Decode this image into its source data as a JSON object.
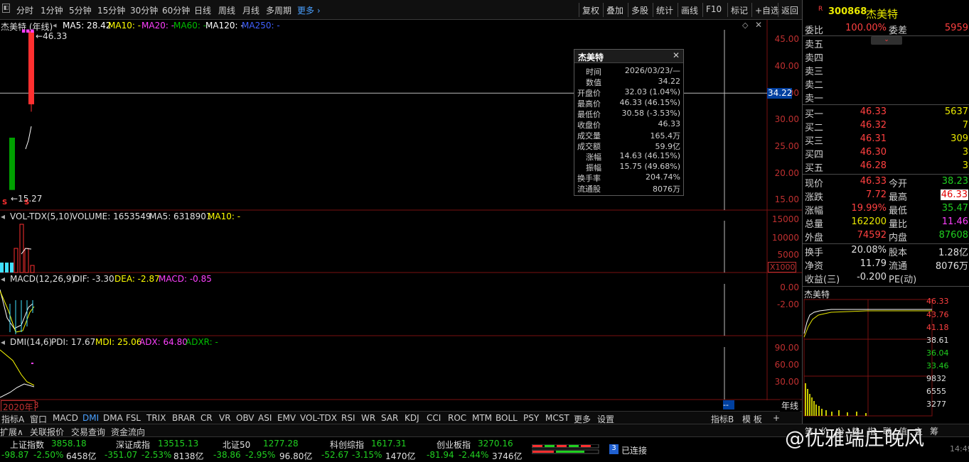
{
  "colors": {
    "up": "#ff3030",
    "down": "#00a000",
    "ma5": "#ffffff",
    "ma10": "#ffff00",
    "ma20": "#ff40ff",
    "ma60": "#00c000",
    "ma250": "#4060ff"
  },
  "toolbar": {
    "periods": [
      "分时",
      "1分钟",
      "5分钟",
      "15分钟",
      "30分钟",
      "60分钟",
      "日线",
      "周线",
      "月线",
      "多周期"
    ],
    "more": "更多",
    "right": [
      "复权",
      "叠加",
      "多股",
      "统计",
      "画线",
      "F10",
      "标记",
      "+自选",
      "返回"
    ]
  },
  "main": {
    "title": "杰美特 (年线)",
    "ma5": "MA5: 28.42",
    "ma10": "MA10: -",
    "ma20": "MA20: -",
    "ma60": "MA60: -",
    "ma120": "MA120: -",
    "ma250": "MA250: -",
    "high_label": "46.33",
    "low_label": "15.27",
    "cursor_price": "34.22",
    "axis": [
      "45.00",
      "40.00",
      "35.00",
      "30.00",
      "25.00",
      "20.00",
      "15.00"
    ]
  },
  "chart_data": [
    {
      "type": "candlestick",
      "x": [
        "2020",
        "2021"
      ],
      "open": [
        25.5,
        32.03
      ],
      "high": [
        25.5,
        46.33
      ],
      "low": [
        15.27,
        30.58
      ],
      "close": [
        15.27,
        46.33
      ],
      "ma5": [
        null,
        28.42
      ],
      "ylim": [
        13,
        48
      ],
      "yticks": [
        45,
        40,
        35,
        30,
        25,
        20,
        15
      ]
    },
    {
      "type": "bar",
      "series": [
        {
          "name": "VOLUME",
          "values": [
            1653549
          ]
        }
      ],
      "yticks": [
        15000,
        10000,
        5000
      ],
      "unit": "X1000"
    },
    {
      "type": "line",
      "series": [
        {
          "name": "DIF",
          "values": [
            -3.3
          ]
        },
        {
          "name": "DEA",
          "values": [
            -2.87
          ]
        },
        {
          "name": "MACD",
          "values": [
            -0.85
          ]
        }
      ],
      "yticks": [
        0,
        -2
      ]
    },
    {
      "type": "line",
      "series": [
        {
          "name": "PDI",
          "values": [
            17.67
          ]
        },
        {
          "name": "MDI",
          "values": [
            25.06
          ]
        },
        {
          "name": "ADX",
          "values": [
            64.8
          ]
        }
      ],
      "yticks": [
        90,
        60,
        30
      ]
    }
  ],
  "vol": {
    "title": "VOL-TDX(5,10)",
    "volume": "VOLUME: 1653549",
    "ma5": "MA5: 6318901",
    "ma10": "MA10: -",
    "axis": [
      "15000",
      "10000",
      "5000"
    ],
    "unit": "X1000"
  },
  "macd": {
    "title": "MACD(12,26,9)",
    "dif": "DIF: -3.30",
    "dea": "DEA: -2.87",
    "macd": "MACD: -0.85",
    "axis": [
      "0.00",
      "-2.00"
    ]
  },
  "dmi": {
    "title": "DMI(14,6)",
    "pdi": "PDI: 17.67",
    "mdi": "MDI: 25.06",
    "adx": "ADX: 64.80",
    "adxr": "ADXR: -",
    "axis": [
      "90.00",
      "60.00",
      "30.00"
    ]
  },
  "xaxis": {
    "year": "2020年",
    "num": "3",
    "cursor": "--"
  },
  "popup": {
    "title": "杰美特",
    "close": "✕",
    "rows": [
      {
        "k": "时间",
        "v": "2026/03/23/—"
      },
      {
        "k": "数值",
        "v": "34.22"
      },
      {
        "k": "开盘价",
        "v": "32.03 (1.04%)"
      },
      {
        "k": "最高价",
        "v": "46.33 (46.15%)"
      },
      {
        "k": "最低价",
        "v": "30.58 (-3.53%)"
      },
      {
        "k": "收盘价",
        "v": "46.33"
      },
      {
        "k": "成交量",
        "v": "165.4万"
      },
      {
        "k": "成交额",
        "v": "59.9亿"
      },
      {
        "k": "涨幅",
        "v": "14.63 (46.15%)"
      },
      {
        "k": "振幅",
        "v": "15.75 (49.68%)"
      },
      {
        "k": "换手率",
        "v": "204.74%"
      },
      {
        "k": "流通股",
        "v": "8076万"
      }
    ]
  },
  "tabs": [
    "指标A",
    "窗口",
    "MACD",
    "DMI",
    "DMA",
    "FSL",
    "TRIX",
    "BRAR",
    "CR",
    "VR",
    "OBV",
    "ASI",
    "EMV",
    "VOL-TDX",
    "RSI",
    "WR",
    "SAR",
    "KDJ",
    "CCI",
    "ROC",
    "MTM",
    "BOLL",
    "PSY",
    "MCST",
    "更多",
    "设置"
  ],
  "tabs_right": [
    "指标B",
    "模 板",
    "+",
    "年线"
  ],
  "bottom_tabs": [
    "扩展∧",
    "关联报价",
    "交易查询",
    "资金流向"
  ],
  "quote": {
    "code": "300868",
    "name": "杰美特",
    "badge": "R",
    "weibi_label": "委比",
    "weibi": "100.00%",
    "weicha_label": "委差",
    "weicha": "5959",
    "sell": [
      {
        "l": "卖五"
      },
      {
        "l": "卖四"
      },
      {
        "l": "卖三"
      },
      {
        "l": "卖二"
      },
      {
        "l": "卖一"
      }
    ],
    "buy": [
      {
        "l": "买一",
        "p": "46.33",
        "v": "5637"
      },
      {
        "l": "买二",
        "p": "46.32",
        "v": "7"
      },
      {
        "l": "买三",
        "p": "46.31",
        "v": "309"
      },
      {
        "l": "买四",
        "p": "46.30",
        "v": "3"
      },
      {
        "l": "买五",
        "p": "46.28",
        "v": "3"
      }
    ],
    "stats": [
      {
        "l": "现价",
        "v1": "46.33",
        "l2": "今开",
        "v2": "38.23"
      },
      {
        "l": "涨跌",
        "v1": "7.72",
        "l2": "最高",
        "v2": "46.33"
      },
      {
        "l": "涨幅",
        "v1": "19.99%",
        "l2": "最低",
        "v2": "35.47"
      },
      {
        "l": "总量",
        "v1": "162200",
        "l2": "量比",
        "v2": "11.46"
      },
      {
        "l": "外盘",
        "v1": "74592",
        "l2": "内盘",
        "v2": "87608"
      }
    ],
    "stats2": [
      {
        "l": "换手",
        "v1": "20.08%",
        "l2": "股本",
        "v2": "1.28亿"
      },
      {
        "l": "净资",
        "v1": "11.79",
        "l2": "流通",
        "v2": "8076万"
      },
      {
        "l": "收益(三)",
        "v1": "-0.200",
        "l2": "PE(动)",
        "v2": ""
      }
    ],
    "mini_title": "杰美特",
    "mini_axis": [
      "46.33",
      "43.76",
      "41.18",
      "38.61",
      "36.04",
      "33.46",
      "9832",
      "6555",
      "3277"
    ],
    "mini_tabs": [
      "笔",
      "价",
      "分",
      "势",
      "指",
      "联",
      "值",
      "主",
      "筹"
    ]
  },
  "status": {
    "indices": [
      {
        "name": "上证指数",
        "val": "3858.18",
        "chg": "-98.87",
        "pct": "-2.50%",
        "amt": "6458亿"
      },
      {
        "name": "深证成指",
        "val": "13515.13",
        "chg": "-351.07",
        "pct": "-2.53%",
        "amt": "8138亿"
      },
      {
        "name": "北证50",
        "val": "1277.28",
        "chg": "-38.86",
        "pct": "-2.95%",
        "amt": "96.80亿"
      },
      {
        "name": "科创综指",
        "val": "1617.31",
        "chg": "-52.67",
        "pct": "-3.15%",
        "amt": "1470亿"
      },
      {
        "name": "创业板指",
        "val": "3270.16",
        "chg": "-81.94",
        "pct": "-2.44%",
        "amt": "3746亿"
      }
    ],
    "conn_num": "3",
    "conn": "已连接",
    "time": "14:49"
  },
  "watermark": "@优雅端庄晚风"
}
